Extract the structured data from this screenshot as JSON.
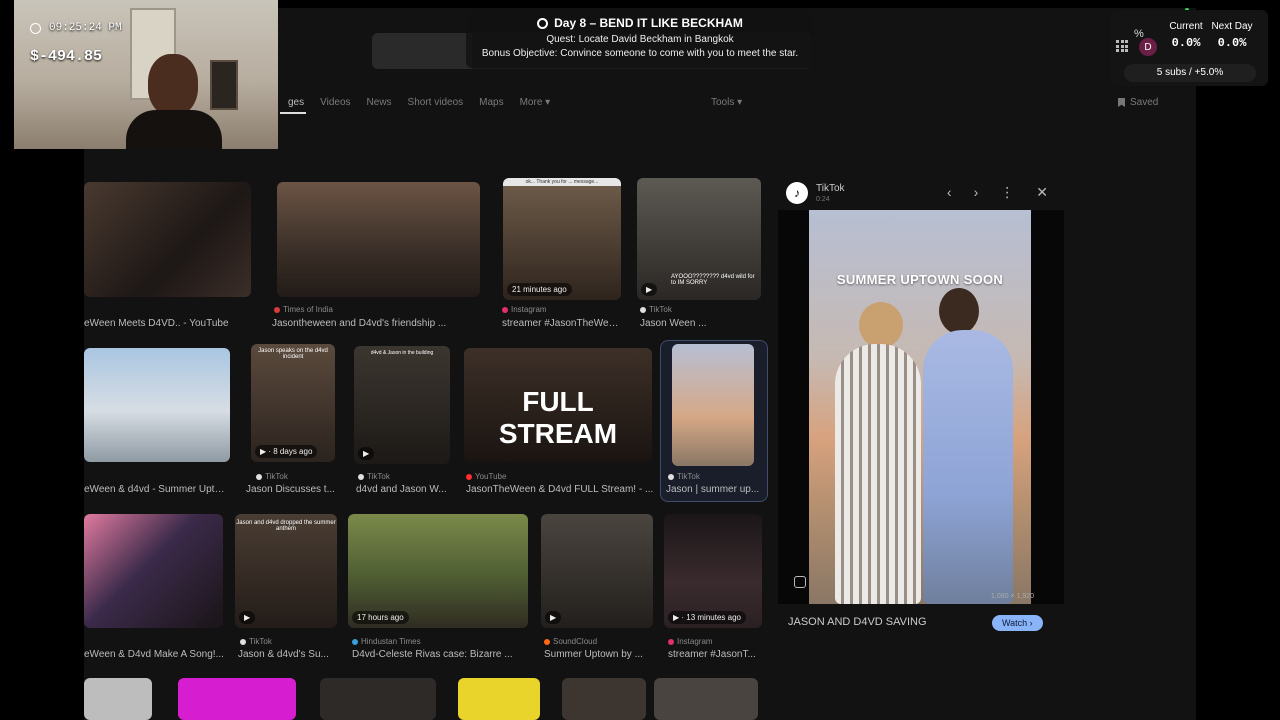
{
  "overlay": {
    "time": "09:25:24 PM",
    "money_symbol": "$",
    "money": "$-494.85",
    "quest_title": "Day 8 – BEND IT LIKE BECKHAM",
    "quest_line": "Quest: Locate David Beckham in Bangkok",
    "bonus_line": "Bonus Objective: Convince someone to come with you to meet the star.",
    "stats": {
      "current_label": "Current",
      "current_value": "0.0%",
      "next_label": "Next Day",
      "next_value": "0.0%",
      "subs": "5 subs / +5.0%",
      "avatar_letter": "D",
      "percent_icon": "%"
    }
  },
  "search": {
    "tabs": [
      "ges",
      "Videos",
      "News",
      "Short videos",
      "Maps",
      "More ▾"
    ],
    "tools": "Tools ▾",
    "saved": "Saved"
  },
  "results": [
    {
      "source": "",
      "title": "eWeen Meets D4VD.. - YouTube",
      "badge": ""
    },
    {
      "source": "Times of India",
      "title": "Jasontheween and D4vd's friendship ...",
      "badge": ""
    },
    {
      "source": "Instagram",
      "title": "streamer #JasonTheWee...",
      "badge": "21 minutes ago",
      "top_text": "ok... Thank you for ... message..."
    },
    {
      "source": "TikTok",
      "title": "Jason Ween ...",
      "badge": "",
      "top_text": "AYOOO???????? d4vd wild for to IM SORRY"
    },
    {
      "source": "",
      "title": "eWeen & d4vd - Summer Upto...",
      "badge": ""
    },
    {
      "source": "TikTok",
      "title": "Jason Discusses t...",
      "badge": "▶ · 8 days ago",
      "top_text": "Jason speaks on the d4vd incident"
    },
    {
      "source": "TikTok",
      "title": "d4vd and Jason W...",
      "badge": "▶",
      "top_text": "d4vd & Jason in the building"
    },
    {
      "source": "YouTube",
      "title": "JasonTheWeen & D4vd FULL Stream! - ...",
      "badge": "",
      "big_text": "FULL STREAM"
    },
    {
      "source": "TikTok",
      "title": "Jason | summer up...",
      "badge": ""
    },
    {
      "source": "",
      "title": "eWeen & D4vd Make A Song!...",
      "badge": ""
    },
    {
      "source": "TikTok",
      "title": "Jason & d4vd's Su...",
      "badge": "▶",
      "top_text": "Jason and d4vd dropped the summer anthem"
    },
    {
      "source": "Hindustan Times",
      "title": "D4vd-Celeste Rivas case: Bizarre ...",
      "badge": "17 hours ago"
    },
    {
      "source": "SoundCloud",
      "title": "Summer Uptown by ...",
      "badge": "▶"
    },
    {
      "source": "Instagram",
      "title": "streamer #JasonT...",
      "badge": "▶ · 13 minutes ago"
    }
  ],
  "preview": {
    "site": "TikTok",
    "duration": "0:24",
    "video_text": "SUMMER UPTOWN SOON",
    "resolution": "1,080 × 1,920",
    "title": "JASON AND D4VD SAVING",
    "watch": "Watch ›",
    "controls": [
      "‹",
      "›",
      "⋮",
      "✕"
    ]
  },
  "colors": {
    "background": "#000000",
    "browser": "#121213",
    "watch_button": "#8ab4f8",
    "avatar": "#6a1f45",
    "youtube": "#ff2d2d",
    "tiktok": "#e0e0e0",
    "instagram": "#e1306c",
    "news": "#d93a3a",
    "soundcloud": "#ff6a1a",
    "hindustan": "#3aa0d6"
  }
}
